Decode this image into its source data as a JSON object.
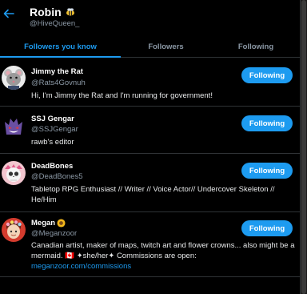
{
  "header": {
    "title": "Robin",
    "title_emoji": "bee-icon",
    "handle": "@HiveQueen_"
  },
  "tabs": [
    {
      "label": "Followers you know",
      "active": true
    },
    {
      "label": "Followers",
      "active": false
    },
    {
      "label": "Following",
      "active": false
    }
  ],
  "accent_color": "#1d9bf0",
  "users": [
    {
      "name": "Jimmy the Rat",
      "handle": "@Rats4Govnuh",
      "bio": "Hi, I'm Jimmy the Rat and I'm running for government!",
      "button": "Following",
      "avatar": "rat-avatar"
    },
    {
      "name": "SSJ Gengar",
      "handle": "@SSJGengar",
      "bio": "rawb's editor",
      "button": "Following",
      "avatar": "gengar-avatar"
    },
    {
      "name": "DeadBones",
      "handle": "@DeadBones5",
      "bio": "Tabletop RPG Enthusiast // Writer // Voice Actor// Undercover Skeleton // He/Him",
      "button": "Following",
      "avatar": "skeleton-avatar"
    },
    {
      "name": "Megan",
      "name_emoji": "sunflower-icon",
      "handle": "@Meganzoor",
      "bio": "Canadian artist, maker of maps, twitch art and flower crowns... also might be a mermaid. 🇨🇦 ✦she/her✦ Commissions are open:",
      "bio_link": "meganzoor.com/commissions",
      "button": "Following",
      "avatar": "megan-avatar"
    }
  ]
}
